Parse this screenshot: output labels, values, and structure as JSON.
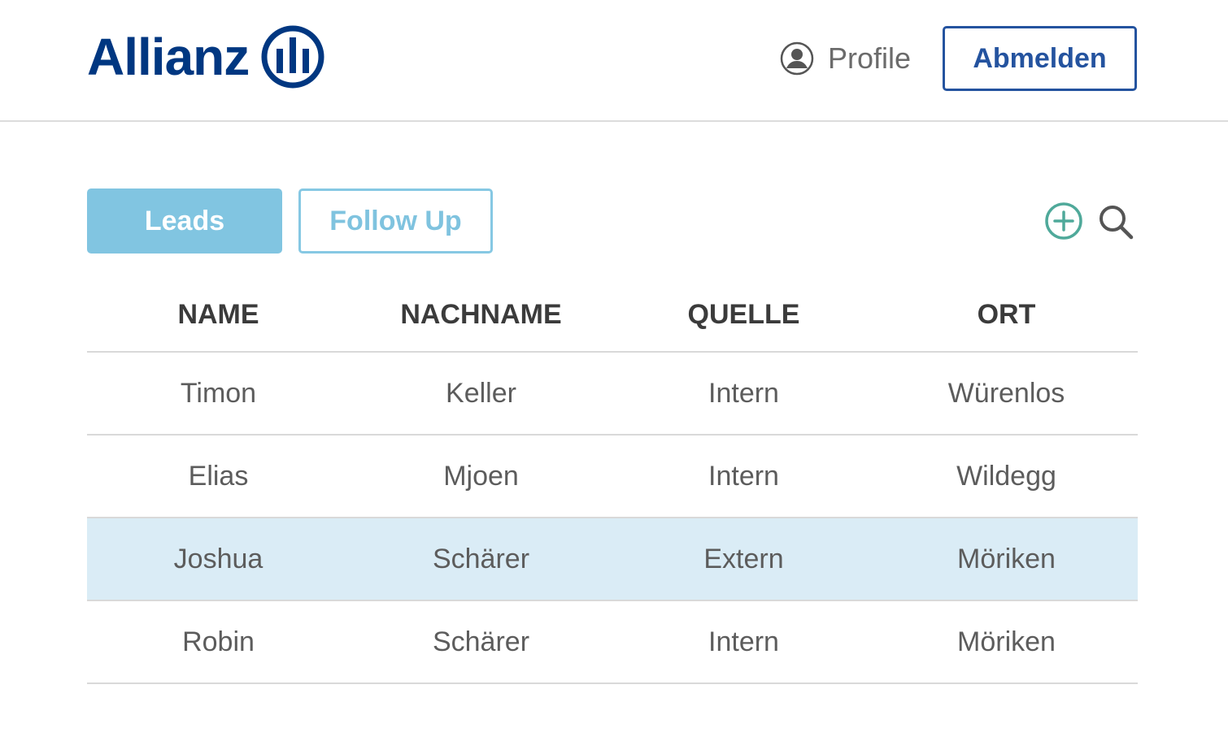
{
  "header": {
    "logo_text": "Allianz",
    "brand_color": "#003781",
    "profile_label": "Profile",
    "profile_icon": "user-circle-icon",
    "logout_label": "Abmelden"
  },
  "tabs": [
    {
      "label": "Leads",
      "active": true
    },
    {
      "label": "Follow Up",
      "active": false
    }
  ],
  "actions": {
    "add_icon": "plus-circle-icon",
    "search_icon": "search-icon"
  },
  "table": {
    "columns": [
      "NAME",
      "NACHNAME",
      "QUELLE",
      "ORT"
    ],
    "rows": [
      {
        "name": "Timon",
        "nachname": "Keller",
        "quelle": "Intern",
        "ort": "Würenlos",
        "selected": false
      },
      {
        "name": "Elias",
        "nachname": "Mjoen",
        "quelle": "Intern",
        "ort": "Wildegg",
        "selected": false
      },
      {
        "name": "Joshua",
        "nachname": "Schärer",
        "quelle": "Extern",
        "ort": "Möriken",
        "selected": true
      },
      {
        "name": "Robin",
        "nachname": "Schärer",
        "quelle": "Intern",
        "ort": "Möriken",
        "selected": false
      }
    ]
  },
  "colors": {
    "accent": "#81c5e1",
    "logout_border": "#24539f",
    "add_icon": "#4fa99a",
    "selected_row": "#daecf6"
  }
}
